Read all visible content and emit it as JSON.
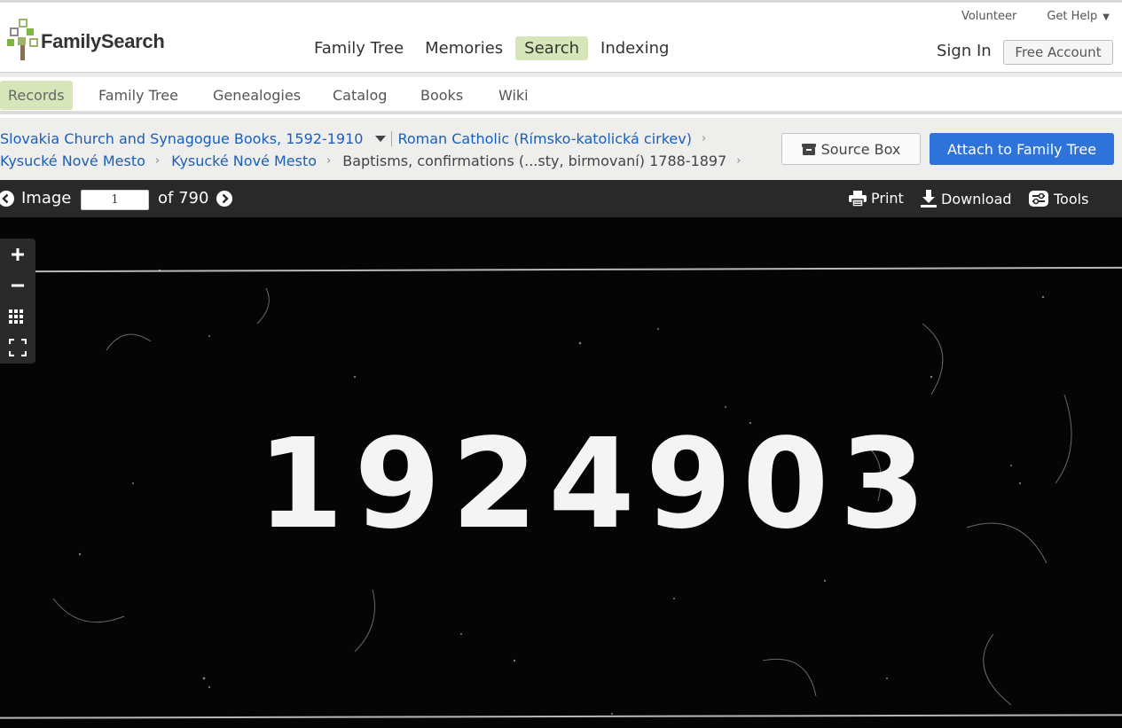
{
  "logo": {
    "text": "FamilySearch"
  },
  "utility_nav": {
    "volunteer": "Volunteer",
    "get_help": "Get Help",
    "get_help_caret": "▼"
  },
  "main_nav": {
    "items": [
      {
        "label": "Family Tree",
        "active": false
      },
      {
        "label": "Memories",
        "active": false
      },
      {
        "label": "Search",
        "active": true
      },
      {
        "label": "Indexing",
        "active": false
      }
    ]
  },
  "account": {
    "sign_in": "Sign In",
    "free_account": "Free Account"
  },
  "sub_nav": {
    "items": [
      {
        "label": "Records",
        "active": true
      },
      {
        "label": "Family Tree",
        "active": false
      },
      {
        "label": "Genealogies",
        "active": false
      },
      {
        "label": "Catalog",
        "active": false
      },
      {
        "label": "Books",
        "active": false
      },
      {
        "label": "Wiki",
        "active": false
      }
    ]
  },
  "breadcrumb": {
    "collection": "Slovakia Church and Synagogue Books, 1592-1910",
    "religion": "Roman Catholic (Rímsko-katolická cirkev)",
    "district": "Kysucké Nové Mesto",
    "parish": "Kysucké Nové Mesto",
    "volume": "Baptisms, confirmations (...sty, birmovaní) 1788-1897",
    "separator": "›"
  },
  "actions": {
    "source_box": "Source Box",
    "attach": "Attach to Family Tree"
  },
  "viewer": {
    "image_label": "Image",
    "current_image": "1",
    "of_label": "of 790",
    "print": "Print",
    "download": "Download",
    "tools": "Tools",
    "image_number": "1924903"
  },
  "colors": {
    "brand_green": "#7db642",
    "active_tab_bg": "#d7e6b9",
    "link_blue": "#1c5fb8",
    "primary_button": "#2d73d9",
    "toolbar_bg": "#292929"
  }
}
